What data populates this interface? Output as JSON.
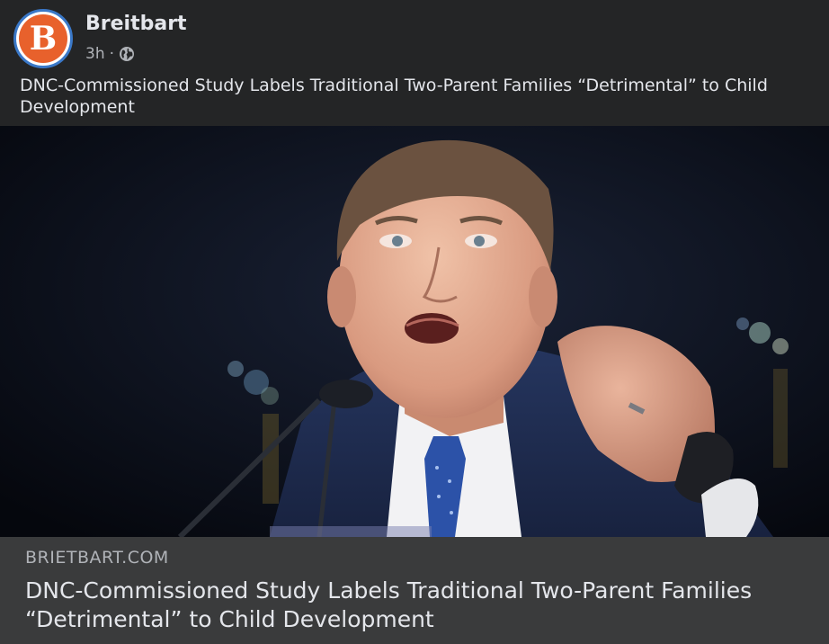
{
  "post": {
    "page_name": "Breitbart",
    "avatar_letter": "B",
    "time": "3h",
    "separator": "·",
    "privacy_icon": "globe-icon",
    "caption": "DNC-Commissioned Study Labels Traditional Two-Parent Families “Detrimental” to Child Development"
  },
  "link_preview": {
    "domain": "BRIETBART.COM",
    "title": "DNC-Commissioned Study Labels Traditional Two-Parent Families “Detrimental” to Child Development"
  },
  "colors": {
    "background": "#242526",
    "footer": "#3a3b3c",
    "brand_orange": "#e8612c",
    "avatar_ring": "#3a78c8"
  }
}
